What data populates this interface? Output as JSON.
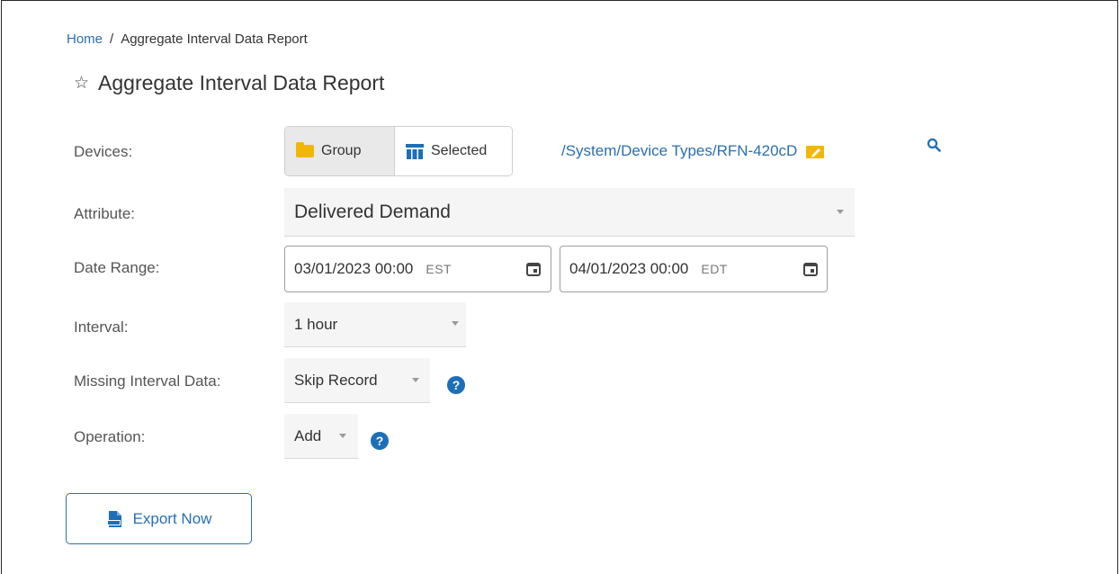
{
  "breadcrumb": {
    "home": "Home",
    "separator": "/",
    "current": "Aggregate Interval Data Report"
  },
  "page": {
    "title": "Aggregate Interval Data Report",
    "favorite_icon": "star-icon"
  },
  "form": {
    "devices": {
      "label": "Devices:",
      "group_label": "Group",
      "selected_label": "Selected",
      "active": "Group",
      "group_path": "/System/Device Types/RFN-420cD",
      "edit_icon": "folder-edit-icon",
      "search_icon": "search-icon"
    },
    "attribute": {
      "label": "Attribute:",
      "value": "Delivered Demand"
    },
    "date_range": {
      "label": "Date Range:",
      "start": "03/01/2023 00:00",
      "start_tz": "EST",
      "end": "04/01/2023 00:00",
      "end_tz": "EDT"
    },
    "interval": {
      "label": "Interval:",
      "value": "1 hour"
    },
    "missing_interval_data": {
      "label": "Missing Interval Data:",
      "value": "Skip Record"
    },
    "operation": {
      "label": "Operation:",
      "value": "Add"
    }
  },
  "actions": {
    "export_label": "Export Now"
  },
  "colors": {
    "link": "#2a6fb0",
    "help": "#1d6fb8",
    "folder": "#f2b705"
  }
}
